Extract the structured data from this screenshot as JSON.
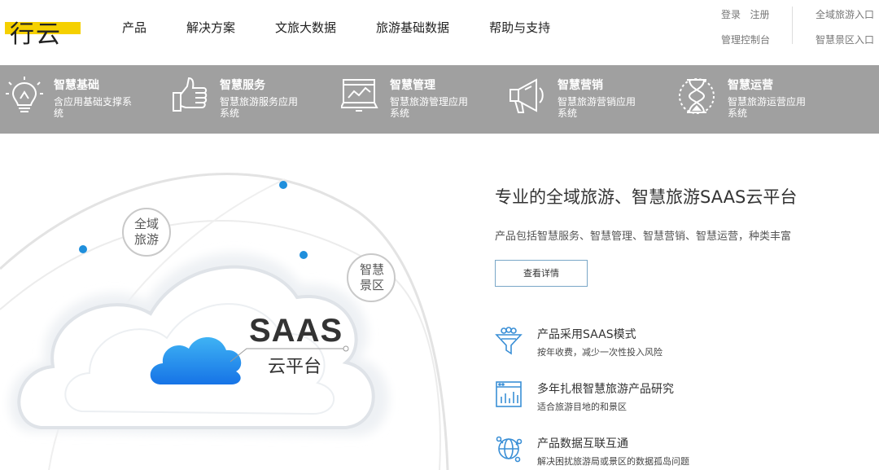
{
  "logo": {
    "text": "行云"
  },
  "nav": {
    "items": [
      "产品",
      "解决方案",
      "文旅大数据",
      "旅游基础数据",
      "帮助与支持"
    ]
  },
  "top_links": {
    "login": "登录",
    "register": "注册",
    "console": "管理控制台",
    "global_tourism_entry": "全域旅游入口",
    "smart_scenic_entry": "智慧景区入口"
  },
  "features": [
    {
      "title": "智慧基础",
      "desc": "含应用基础支撑系统",
      "icon": "lightbulb-icon"
    },
    {
      "title": "智慧服务",
      "desc": "智慧旅游服务应用系统",
      "icon": "thumbs-up-icon"
    },
    {
      "title": "智慧管理",
      "desc": "智慧旅游管理应用系统",
      "icon": "monitor-chart-icon"
    },
    {
      "title": "智慧营销",
      "desc": "智慧旅游营销应用系统",
      "icon": "megaphone-icon"
    },
    {
      "title": "智慧运营",
      "desc": "智慧旅游运营应用系统",
      "icon": "hourglass-icon"
    }
  ],
  "hero": {
    "saas": "SAAS",
    "platform": "云平台",
    "bubble_global": "全域旅游",
    "bubble_scenic": "智慧景区",
    "headline": "专业的全域旅游、智慧旅游SAAS云平台",
    "subline": "产品包括智慧服务、智慧管理、智慧营销、智慧运营，种类丰富",
    "detail_button": "查看详情"
  },
  "bullets": [
    {
      "title": "产品采用SAAS模式",
      "desc": "按年收费，减少一次性投入风险",
      "icon": "funnel-icon"
    },
    {
      "title": "多年扎根智慧旅游产品研究",
      "desc": "适合旅游目地的和景区",
      "icon": "analytics-window-icon"
    },
    {
      "title": "产品数据互联互通",
      "desc": "解决困扰旅游局或景区的数据孤岛问题",
      "icon": "connected-globe-icon"
    }
  ],
  "colors": {
    "logo_yellow": "#f5d000",
    "band_grey": "#a0a0a0",
    "cloud_blue": "#1e88e5",
    "dot_blue": "#1f8fdc",
    "button_border": "#7aa7c7",
    "icon_blue": "#3a8fd6"
  }
}
